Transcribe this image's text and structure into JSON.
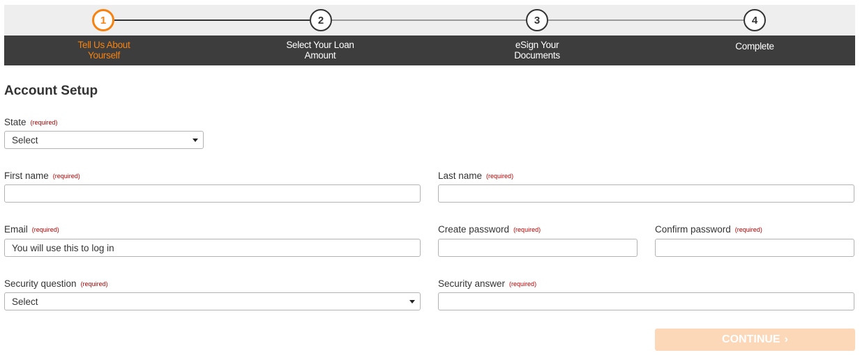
{
  "stepper": {
    "steps": [
      {
        "number": "1",
        "label_line1": "Tell Us About",
        "label_line2": "Yourself",
        "state": "active"
      },
      {
        "number": "2",
        "label_line1": "Select Your Loan",
        "label_line2": "Amount",
        "state": "upcoming"
      },
      {
        "number": "3",
        "label_line1": "eSign Your",
        "label_line2": "Documents",
        "state": "upcoming"
      },
      {
        "number": "4",
        "label_line1": "Complete",
        "label_line2": "",
        "state": "upcoming"
      }
    ],
    "active_color": "#f7820f"
  },
  "form": {
    "title": "Account Setup",
    "required_text": "(required)",
    "state": {
      "label": "State",
      "value": "Select"
    },
    "first_name": {
      "label": "First name",
      "value": ""
    },
    "last_name": {
      "label": "Last name",
      "value": ""
    },
    "email": {
      "label": "Email",
      "placeholder": "You will use this to log in"
    },
    "create_password": {
      "label": "Create password",
      "value": ""
    },
    "confirm_password": {
      "label": "Confirm password",
      "value": ""
    },
    "security_question": {
      "label": "Security question",
      "value": "Select"
    },
    "security_answer": {
      "label": "Security answer",
      "value": ""
    }
  },
  "actions": {
    "continue_label": "CONTINUE",
    "continue_icon": "›"
  }
}
